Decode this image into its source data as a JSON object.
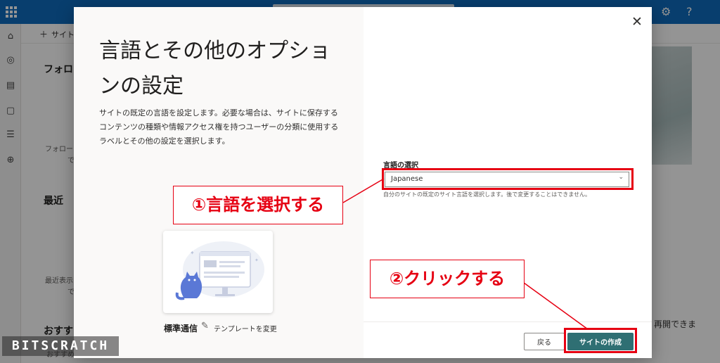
{
  "background": {
    "command_bar": {
      "new_site_label": "サイト"
    },
    "following_heading": "フォロー",
    "following_empty_text": "フォロー",
    "following_empty_text2": "で",
    "recent_heading": "最近",
    "recent_empty_text": "最近表示",
    "recent_empty_text2": "で",
    "recommended_heading": "おすす",
    "recommended_sub": "おすすめ",
    "resume_text": "再開できま"
  },
  "dialog": {
    "title": "言語とその他のオプションの設定",
    "description": "サイトの既定の言語を設定します。必要な場合は、サイトに保存するコンテンツの種類や情報アクセス権を持つユーザーの分類に使用するラベルとその他の設定を選択します。",
    "template": {
      "name": "標準通信",
      "change_label": "テンプレートを変更"
    },
    "language": {
      "label": "言語の選択",
      "value": "Japanese",
      "hint": "自分のサイトの既定のサイト言語を選択します。後で変更することはできません。"
    },
    "buttons": {
      "back": "戻る",
      "create": "サイトの作成"
    }
  },
  "annotations": {
    "step1": "①言語を選択する",
    "step2": "②クリックする",
    "color": "#e60012"
  },
  "watermark": "BITSCRATCH",
  "colors": {
    "suite_bar": "#0f6cbd",
    "primary_button": "#2f6f73"
  }
}
